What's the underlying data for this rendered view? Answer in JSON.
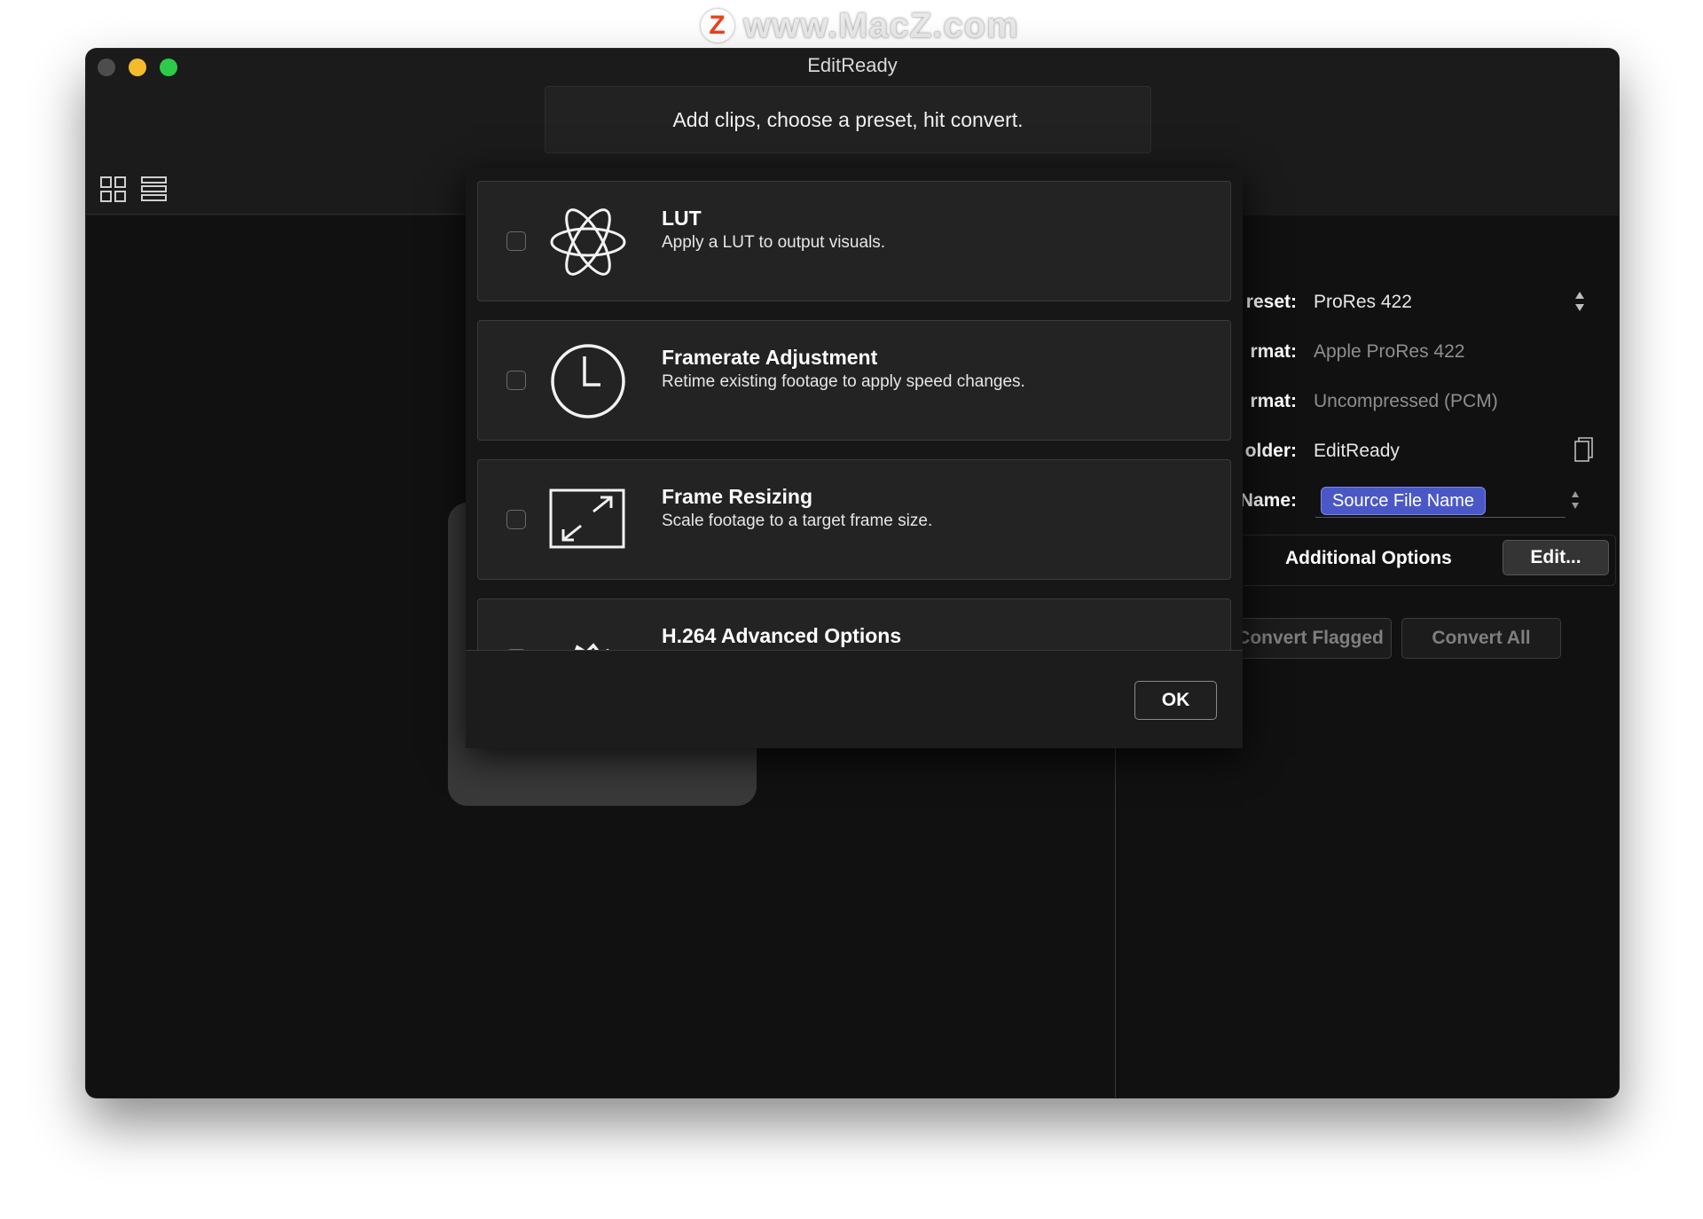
{
  "watermark": {
    "logo_letter": "Z",
    "text": "www.MacZ.com"
  },
  "window": {
    "title": "EditReady"
  },
  "hint": {
    "text": "Add clips, choose a preset, hit convert."
  },
  "view_modes": {
    "grid_icon": "grid-view-icon",
    "list_icon": "list-view-icon"
  },
  "settings": {
    "preset": {
      "label": "reset:",
      "value": "ProRes 422"
    },
    "video_format": {
      "label": "rmat:",
      "value": "Apple ProRes 422"
    },
    "audio_format": {
      "label": "rmat:",
      "value": "Uncompressed (PCM)"
    },
    "folder": {
      "label": "older:",
      "value": "EditReady"
    },
    "name": {
      "label": "Name:",
      "token": "Source File Name"
    },
    "additional_options": {
      "label": "Additional Options",
      "edit_button": "Edit..."
    },
    "convert_flagged": "Convert Flagged",
    "convert_all": "Convert All"
  },
  "modal": {
    "options": [
      {
        "title": "LUT",
        "description": "Apply a LUT to output visuals.",
        "icon": "atom-icon",
        "checked": false
      },
      {
        "title": "Framerate Adjustment",
        "description": "Retime existing footage to apply speed changes.",
        "icon": "clock-icon",
        "checked": false
      },
      {
        "title": "Frame Resizing",
        "description": "Scale footage to a target frame size.",
        "icon": "resize-arrows-icon",
        "checked": false
      },
      {
        "title": "H.264 Advanced Options",
        "description": "",
        "icon": "gear-icon",
        "checked": false
      }
    ],
    "ok_button": "OK"
  },
  "colors": {
    "accent_token": "#4a58c7",
    "traffic_close": "#4d4d4d",
    "traffic_minimize": "#f6bb2d",
    "traffic_maximize": "#2ccb4a"
  }
}
